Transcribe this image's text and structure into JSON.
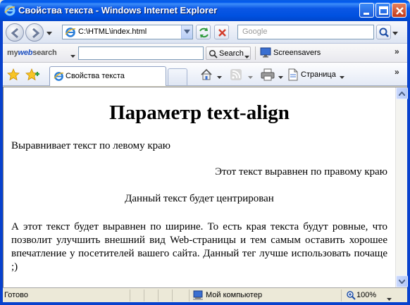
{
  "window": {
    "title": "Свойства текста - Windows Internet Explorer"
  },
  "address_bar": {
    "url": "C:\\HTML\\index.html",
    "search_placeholder": "Google"
  },
  "toolbar_mywebsearch": {
    "logo_prefix": "my",
    "logo_web": "web",
    "logo_suffix": "search",
    "search_label": "Search",
    "screensavers_label": "Screensavers",
    "more": "»"
  },
  "tabs": {
    "active_tab_label": "Свойства текста",
    "page_menu_label": "Страница",
    "more": "»"
  },
  "page": {
    "heading": "Параметр text-align",
    "left_text": "Выравнивает текст по левому краю",
    "right_text": "Этот текст выравнен по правому краю",
    "center_text": "Данный текст будет центрирован",
    "justify_text": "А этот текст будет выравнен по ширине. То есть края текста будут ровные, что позволит улучшить внешний вид Web-страницы и тем самым оставить хорошее впечатление у посетителей вашего сайта. Данный тег лучше использовать почаще ;)"
  },
  "statusbar": {
    "status": "Готово",
    "zone": "Мой компьютер",
    "zoom": "100%"
  },
  "colors": {
    "titlebar": "#0058EE",
    "frame": "#0841CD",
    "chrome": "#ECE9D8"
  }
}
